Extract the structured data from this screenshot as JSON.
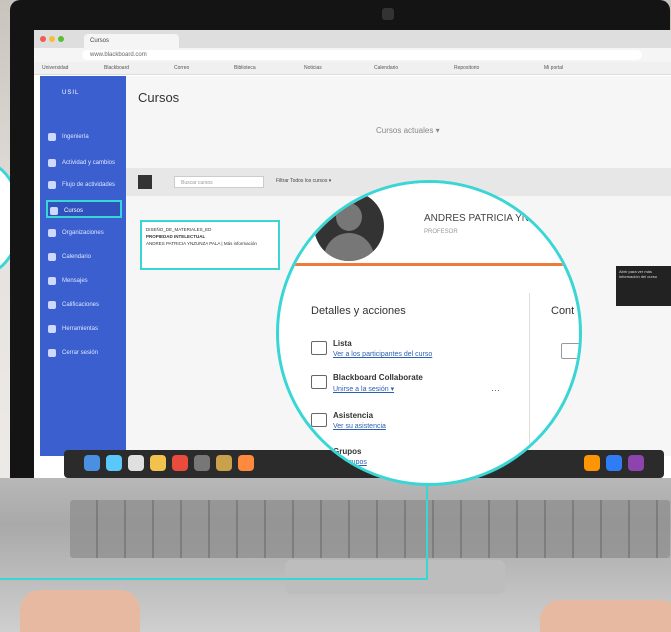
{
  "browser": {
    "tab_title": "Cursos",
    "url": "www.blackboard.com",
    "bookmarks": [
      "Universidad",
      "Blackboard",
      "Correo",
      "Biblioteca",
      "Noticias",
      "Calendario",
      "Repositorio",
      "Mi portal"
    ]
  },
  "sidebar": {
    "logo": "USIL",
    "items": [
      {
        "label": "Ingeniería"
      },
      {
        "label": "Actividad y cambios"
      },
      {
        "label": "Flujo de actividades"
      },
      {
        "label": "Cursos"
      },
      {
        "label": "Organizaciones"
      },
      {
        "label": "Calendario"
      },
      {
        "label": "Mensajes"
      },
      {
        "label": "Calificaciones"
      },
      {
        "label": "Herramientas"
      },
      {
        "label": "Cerrar sesión"
      }
    ]
  },
  "main": {
    "title": "Cursos",
    "current_courses": "Cursos actuales ▾",
    "search_placeholder": "Buscar cursos",
    "filter": "Filtrar  Todos los cursos ▾",
    "card": {
      "line1": "DISEÑO_DE_MATERIALES_ED",
      "line2": "PROPIEDAD INTELECTUAL",
      "line3": "ANDRES PATRICIA YNZUNZA PALA  |  Más información"
    },
    "tooltip": "Abrir para ver más información del curso"
  },
  "magnifier": {
    "name": "ANDRES PATRICIA YN",
    "role": "PROFESOR",
    "details_title": "Detalles y acciones",
    "content_title": "Cont",
    "rows": [
      {
        "label": "Lista",
        "link": "Ver a los participantes del curso"
      },
      {
        "label": "Blackboard Collaborate",
        "link": "Unirse a la sesión ▾"
      },
      {
        "label": "Asistencia",
        "link": "Ver su asistencia"
      },
      {
        "label": "Grupos",
        "link": "Ver grupos"
      }
    ],
    "more": "···"
  },
  "colors": {
    "accent": "#3ad6d6",
    "sidebar": "#3b5fcf",
    "header_border": "#f07a3a"
  }
}
